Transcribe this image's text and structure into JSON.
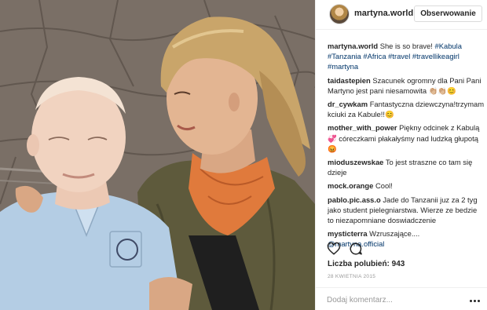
{
  "header": {
    "username": "martyna.world",
    "follow_label": "Obserwowanie"
  },
  "caption": {
    "user": "martyna.world",
    "text": "She is so brave!",
    "tags": [
      "#Kabula",
      "#Tanzania",
      "#Africa",
      "#travel",
      "#travellikeagirl",
      "#martyna"
    ]
  },
  "comments": [
    {
      "user": "taidastepien",
      "text": "Szacunek ogromny dla Pani Pani Martyno jest pani niesamowita 👏🏼👏🏼😊"
    },
    {
      "user": "dr_cywkam",
      "text": "Fantastyczna dziewczyna!trzymam kciuki za Kabule!!😊"
    },
    {
      "user": "mother_with_power",
      "text": "Piękny odcinek z Kabulą💞 córeczkami płakałyśmy nad ludzką głupotą😡"
    },
    {
      "user": "mioduszewskae",
      "text": "To jest straszne co tam się dzieje"
    },
    {
      "user": "mock.orange",
      "text": "Cool!"
    },
    {
      "user": "pablo.pic.ass.o",
      "text": "Jade do Tanzanii juz za 2 tyg jako student pielegniarstwa. Wierze ze bedzie to niezapomniane doswiadczenie"
    },
    {
      "user": "mysticterra",
      "text": "Wzruszające....",
      "mention": "@martyna.official"
    }
  ],
  "likes_text": "Liczba polubień: 943",
  "date_text": "28 KWIETNIA 2015",
  "add_comment": {
    "placeholder": "Dodaj komentarz..."
  },
  "icons": {
    "like": "heart-icon",
    "comment": "comment-bubble-icon",
    "more": "more-dots-icon"
  }
}
